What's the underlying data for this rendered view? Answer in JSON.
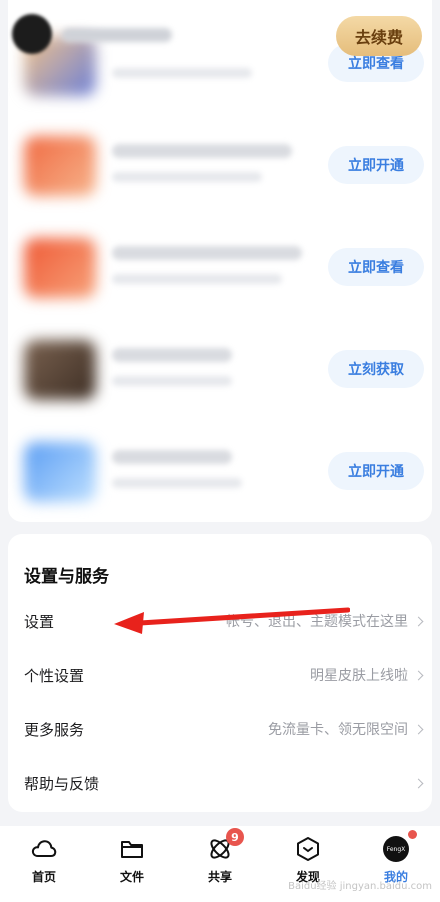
{
  "header": {
    "renew_label": "去续费"
  },
  "promos": [
    {
      "button": "立即查看",
      "colors": [
        "#f2c38a",
        "#6b7fd8"
      ]
    },
    {
      "button": "立即开通",
      "colors": [
        "#f06a42",
        "#f7b48c"
      ]
    },
    {
      "button": "立即查看",
      "colors": [
        "#ef5a36",
        "#f7a27a"
      ]
    },
    {
      "button": "立刻获取",
      "colors": [
        "#7a6250",
        "#3d2e24"
      ]
    },
    {
      "button": "立即开通",
      "colors": [
        "#5a9df3",
        "#bfe0ff"
      ]
    }
  ],
  "settings": {
    "title": "设置与服务",
    "items": [
      {
        "label": "设置",
        "hint": "帐号、退出、主题模式在这里"
      },
      {
        "label": "个性设置",
        "hint": "明星皮肤上线啦"
      },
      {
        "label": "更多服务",
        "hint": "免流量卡、领无限空间"
      },
      {
        "label": "帮助与反馈",
        "hint": ""
      }
    ]
  },
  "nav": {
    "items": [
      {
        "label": "首页",
        "icon": "cloud-icon"
      },
      {
        "label": "文件",
        "icon": "folder-icon"
      },
      {
        "label": "共享",
        "icon": "share-icon",
        "badge": "9"
      },
      {
        "label": "发现",
        "icon": "discover-icon"
      },
      {
        "label": "我的",
        "icon": "avatar-icon",
        "avatar_text": "FengX"
      }
    ]
  },
  "watermark": "Baidu经验 jingyan.baidu.com",
  "colors": {
    "accent": "#3a7ee0",
    "badge": "#e8554e",
    "renew_gold": "#e5bd7b"
  }
}
